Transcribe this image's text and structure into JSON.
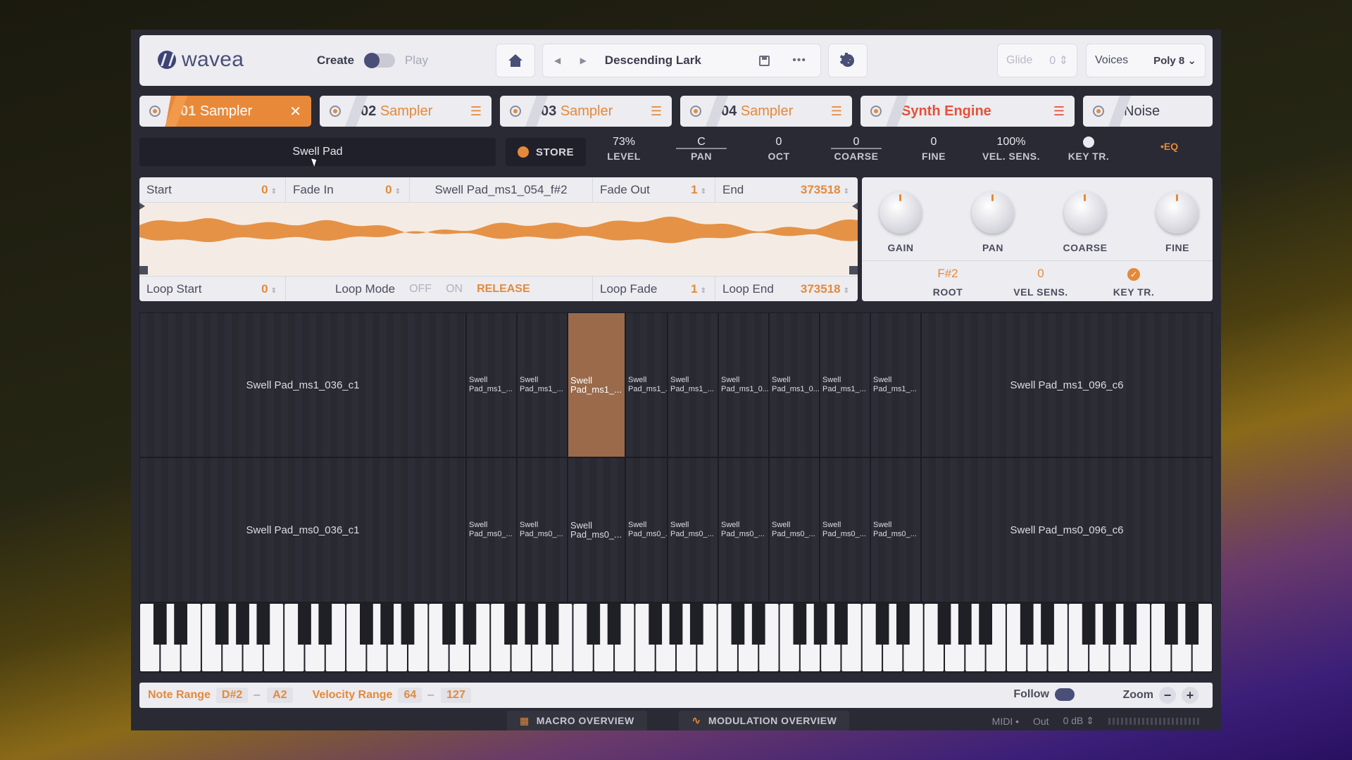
{
  "app": {
    "logo": "wavea"
  },
  "header": {
    "mode_create": "Create",
    "mode_play": "Play",
    "preset_name": "Descending Lark",
    "preset_nav": "◀ ▶",
    "more": "•••",
    "glide_label": "Glide",
    "glide_value": "0 ⇕",
    "voices_label": "Voices",
    "voices_value": "Poly 8 ⌄"
  },
  "tabs": [
    {
      "num": "01",
      "label": "Sampler",
      "icon": "close-icon",
      "glyph": "✕"
    },
    {
      "num": "02",
      "label": "Sampler",
      "icon": "sliders-icon",
      "glyph": "☰"
    },
    {
      "num": "03",
      "label": "Sampler",
      "icon": "sliders-icon",
      "glyph": "☰"
    },
    {
      "num": "04",
      "label": "Sampler",
      "icon": "sliders-icon",
      "glyph": "☰"
    },
    {
      "num": "Synth",
      "label": "Engine",
      "icon": "sliders-icon",
      "glyph": "☰"
    },
    {
      "num": "",
      "label": "Noise"
    }
  ],
  "layer": {
    "sample_name": "Swell Pad",
    "store_label": "STORE",
    "params": [
      {
        "value": "73%",
        "label": "LEVEL"
      },
      {
        "value": "C",
        "label": "PAN"
      },
      {
        "value": "0",
        "label": "OCT"
      },
      {
        "value": "0",
        "label": "COARSE"
      },
      {
        "value": "0",
        "label": "FINE"
      },
      {
        "value": "100%",
        "label": "VEL. SENS."
      },
      {
        "value": "",
        "label": "KEY TR."
      }
    ],
    "eq_label": "•EQ"
  },
  "sample_editor": {
    "start_label": "Start",
    "start_value": "0",
    "fade_in_label": "Fade In",
    "fade_in_value": "0",
    "file_name": "Swell Pad_ms1_054_f#2",
    "fade_out_label": "Fade Out",
    "fade_out_value": "1",
    "end_label": "End",
    "end_value": "373518",
    "loop_start_label": "Loop Start",
    "loop_start_value": "0",
    "loop_mode_label": "Loop Mode",
    "loop_off": "OFF",
    "loop_on": "ON",
    "loop_release": "RELEASE",
    "loop_fade_label": "Loop Fade",
    "loop_fade_value": "1",
    "loop_end_label": "Loop End",
    "loop_end_value": "373518"
  },
  "knobs": [
    {
      "label": "GAIN"
    },
    {
      "label": "PAN"
    },
    {
      "label": "COARSE"
    },
    {
      "label": "FINE"
    }
  ],
  "zone_params": {
    "root_value": "F#2",
    "root_label": "ROOT",
    "vel_sens_value": "0",
    "vel_sens_label": "VEL SENS.",
    "key_tr_label": "KEY TR."
  },
  "zones": {
    "top_row": [
      "Swell Pad_ms1_036_c1",
      "Swell Pad_ms1_...",
      "Swell Pad_ms1_...",
      "Swell Pad_ms1_...",
      "Swell Pad_ms1_...",
      "Swell Pad_ms1_...",
      "Swell Pad_ms1_0...",
      "Swell Pad_ms1_0...",
      "Swell Pad_ms1_...",
      "Swell Pad_ms1_...",
      "Swell Pad_ms1_096_c6"
    ],
    "bottom_row": [
      "Swell Pad_ms0_036_c1",
      "Swell Pad_ms0_...",
      "Swell Pad_ms0_...",
      "Swell Pad_ms0_...",
      "Swell Pad_ms0_...",
      "Swell Pad_ms0_...",
      "Swell Pad_ms0_...",
      "Swell Pad_ms0_...",
      "Swell Pad_ms0_...",
      "Swell Pad_ms0_...",
      "Swell Pad_ms0_096_c6"
    ],
    "selected_index": 3
  },
  "footer": {
    "note_range_label": "Note Range",
    "note_low": "D#2",
    "note_high": "A2",
    "velocity_range_label": "Velocity Range",
    "vel_low": "64",
    "vel_high": "127",
    "dash": "–",
    "follow_label": "Follow",
    "zoom_label": "Zoom",
    "zoom_out": "−",
    "zoom_in": "+"
  },
  "bottom": {
    "macro_label": "MACRO OVERVIEW",
    "modulation_label": "MODULATION OVERVIEW",
    "midi_label": "MIDI •",
    "out_label": "Out",
    "out_value": "0 dB ⇕"
  },
  "colors": {
    "accent": "#e38a3a",
    "synth": "#e2523a",
    "panel": "#ececf1",
    "dark": "#2a2a34"
  }
}
